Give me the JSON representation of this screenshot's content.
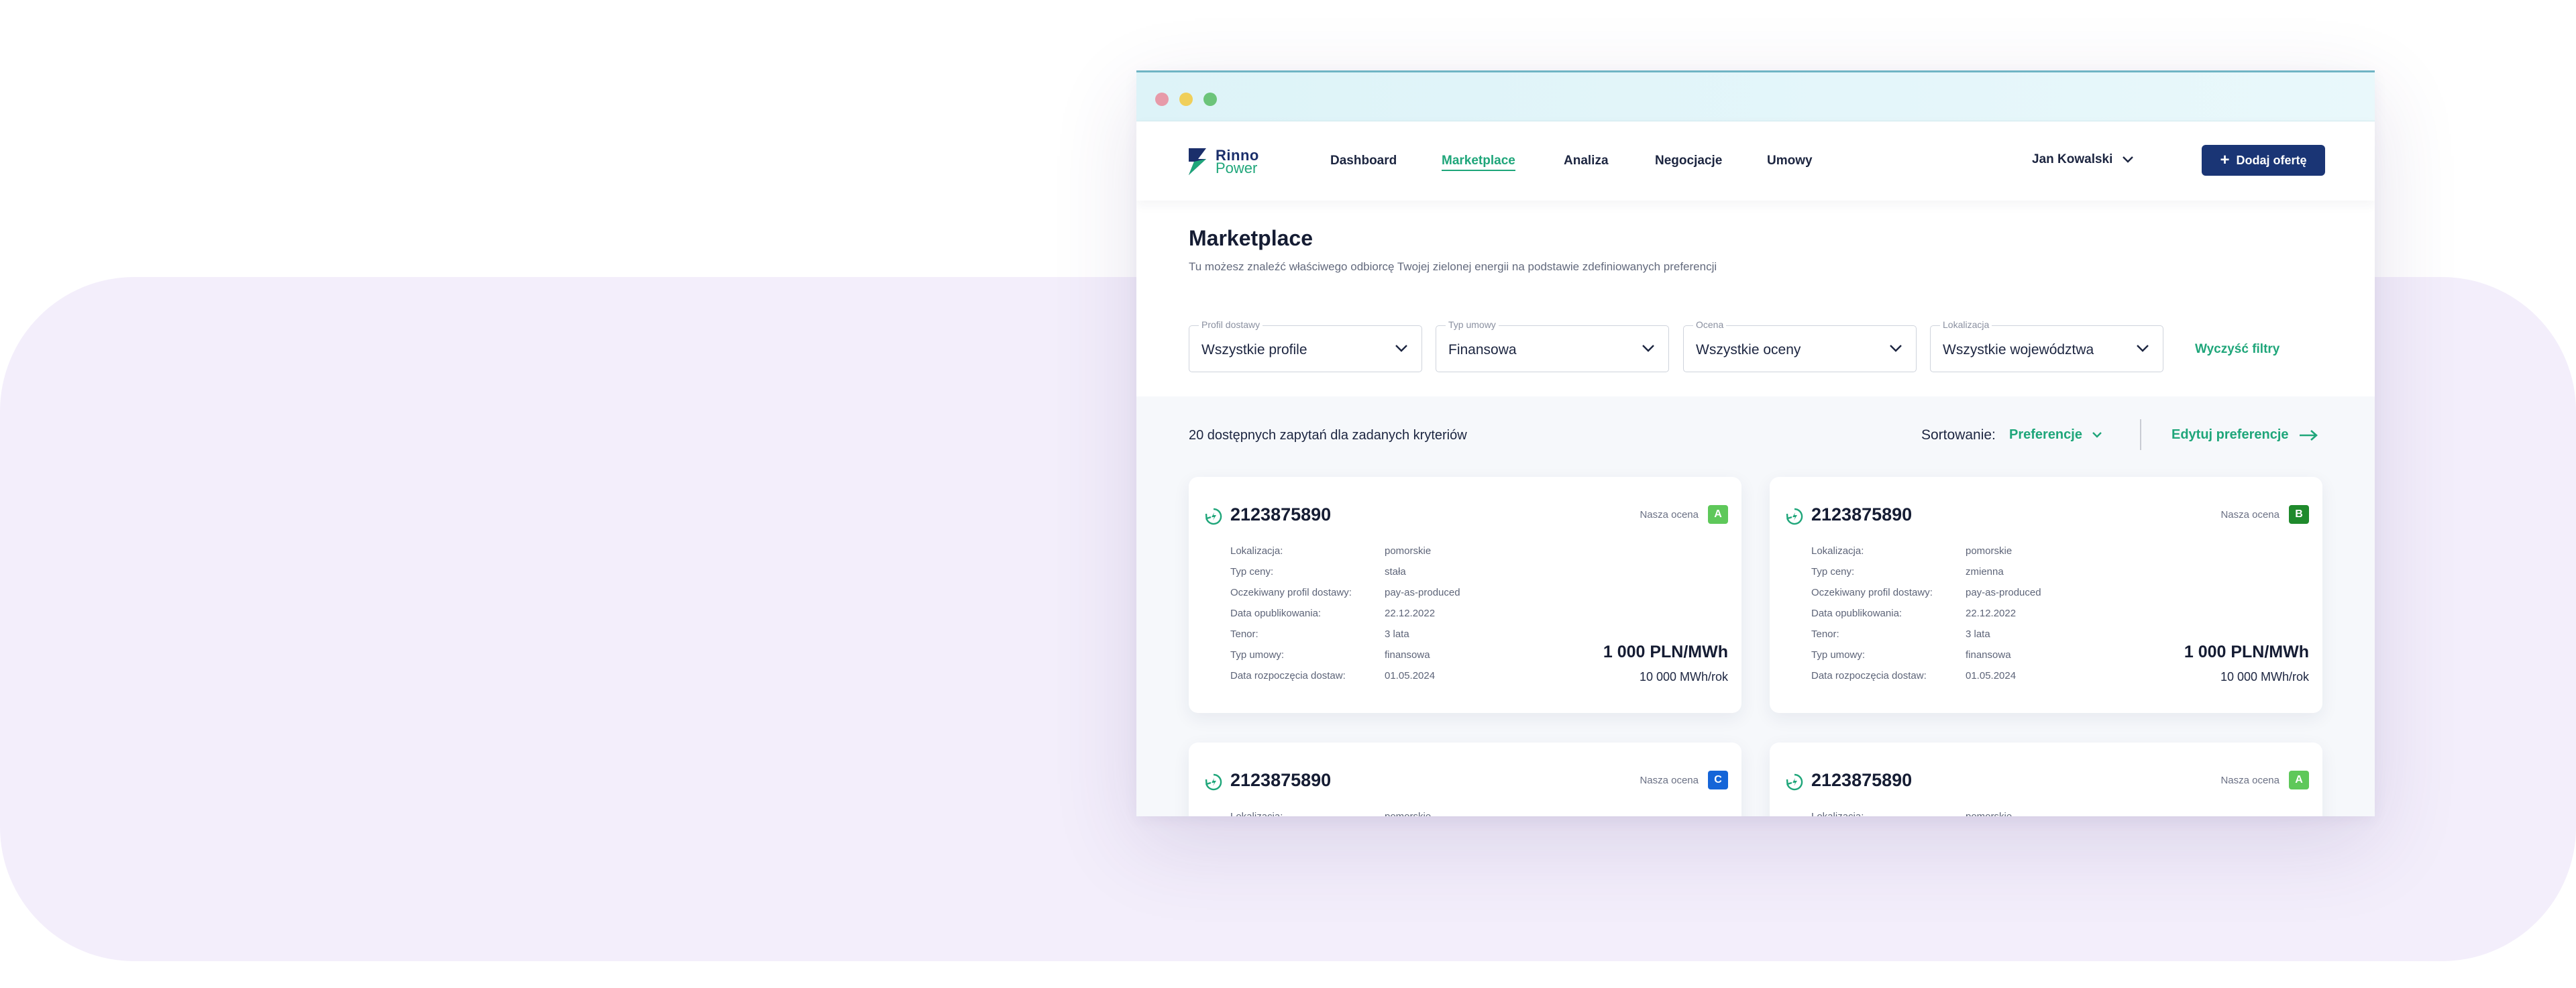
{
  "nav": {
    "logo_line1": "Rinno",
    "logo_line2": "Power",
    "items": [
      "Dashboard",
      "Marketplace",
      "Analiza",
      "Negocjacje",
      "Umowy"
    ],
    "user_name": "Jan Kowalski",
    "add_offer_label": "Dodaj ofertę"
  },
  "page": {
    "title": "Marketplace",
    "subtitle": "Tu możesz znaleźć właściwego odbiorcę Twojej zielonej energii na podstawie zdefiniowanych preferencji"
  },
  "filters": [
    {
      "label": "Profil dostawy",
      "value": "Wszystkie profile"
    },
    {
      "label": "Typ umowy",
      "value": "Finansowa"
    },
    {
      "label": "Ocena",
      "value": "Wszystkie oceny"
    },
    {
      "label": "Lokalizacja",
      "value": "Wszystkie województwa"
    }
  ],
  "clear_filters_label": "Wyczyść filtry",
  "results": {
    "count_text": "20 dostępnych zapytań dla zadanych kryteriów",
    "sort_label": "Sortowanie:",
    "sort_value": "Preferencje",
    "edit_preferences_label": "Edytuj preferencje"
  },
  "colors": {
    "brand_navy": "#1a3575",
    "brand_green": "#1fa67a",
    "grade_a": "#5ec85a",
    "grade_b": "#1f8a2c",
    "grade_c": "#1565d8"
  },
  "cards": [
    {
      "id": "2123875890",
      "rating_label": "Nasza ocena",
      "rating": "A",
      "props": [
        {
          "k": "Lokalizacja:",
          "v": "pomorskie"
        },
        {
          "k": "Typ ceny:",
          "v": "stała"
        },
        {
          "k": "Oczekiwany profil dostawy:",
          "v": "pay-as-produced"
        },
        {
          "k": "Data opublikowania:",
          "v": "22.12.2022"
        },
        {
          "k": "Tenor:",
          "v": "3 lata"
        },
        {
          "k": "Typ umowy:",
          "v": "finansowa"
        },
        {
          "k": "Data rozpoczęcia dostaw:",
          "v": "01.05.2024"
        }
      ],
      "price": "1 000 PLN/MWh",
      "volume": "10 000 MWh/rok"
    },
    {
      "id": "2123875890",
      "rating_label": "Nasza ocena",
      "rating": "B",
      "props": [
        {
          "k": "Lokalizacja:",
          "v": "pomorskie"
        },
        {
          "k": "Typ ceny:",
          "v": "zmienna"
        },
        {
          "k": "Oczekiwany profil dostawy:",
          "v": "pay-as-produced"
        },
        {
          "k": "Data opublikowania:",
          "v": "22.12.2022"
        },
        {
          "k": "Tenor:",
          "v": "3 lata"
        },
        {
          "k": "Typ umowy:",
          "v": "finansowa"
        },
        {
          "k": "Data rozpoczęcia dostaw:",
          "v": "01.05.2024"
        }
      ],
      "price": "1 000 PLN/MWh",
      "volume": "10 000 MWh/rok"
    },
    {
      "id": "2123875890",
      "rating_label": "Nasza ocena",
      "rating": "C",
      "props": [
        {
          "k": "Lokalizacja:",
          "v": "pomorskie"
        }
      ],
      "price": "",
      "volume": ""
    },
    {
      "id": "2123875890",
      "rating_label": "Nasza ocena",
      "rating": "A",
      "props": [
        {
          "k": "Lokalizacja:",
          "v": "pomorskie"
        }
      ],
      "price": "",
      "volume": ""
    }
  ]
}
